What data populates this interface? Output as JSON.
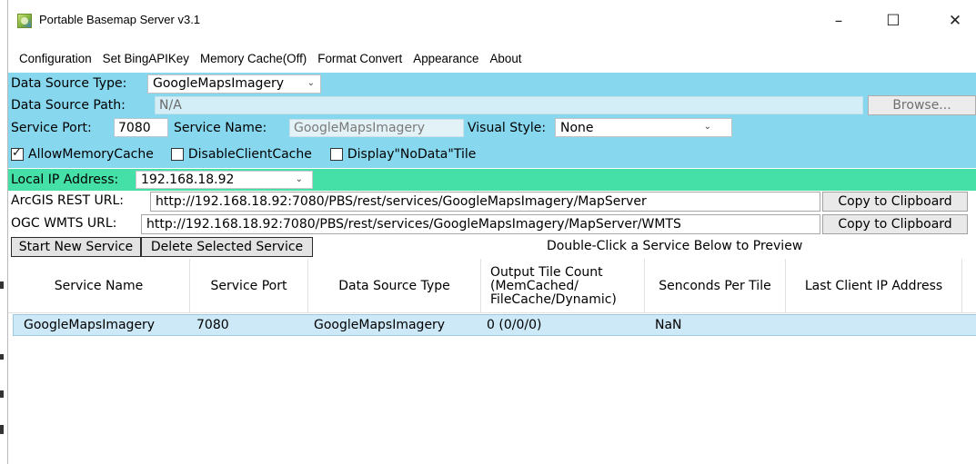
{
  "window": {
    "title": "Portable Basemap Server v3.1",
    "controls": {
      "minimize": "–",
      "maximize": "☐",
      "close": "✕"
    }
  },
  "menu": {
    "items": [
      "Configuration",
      "Set BingAPIKey",
      "Memory Cache(Off)",
      "Format Convert",
      "Appearance",
      "About"
    ]
  },
  "config": {
    "data_source_type_label": "Data Source Type:",
    "data_source_type_value": "GoogleMapsImagery",
    "data_source_path_label": "Data Source Path:",
    "data_source_path_value": "N/A",
    "browse_label": "Browse...",
    "service_port_label": "Service Port:",
    "service_port_value": "7080",
    "service_name_label": "Service Name:",
    "service_name_value": "GoogleMapsImagery",
    "visual_style_label": "Visual Style:",
    "visual_style_value": "None",
    "checkboxes": [
      {
        "label": "AllowMemoryCache",
        "checked": true
      },
      {
        "label": "DisableClientCache",
        "checked": false
      },
      {
        "label": "Display\"NoData\"Tile",
        "checked": false
      }
    ]
  },
  "network": {
    "local_ip_label": "Local IP Address:",
    "local_ip_value": "192.168.18.92",
    "arcgis_label": "ArcGIS REST URL:",
    "arcgis_url": "http://192.168.18.92:7080/PBS/rest/services/GoogleMapsImagery/MapServer",
    "wmts_label": "OGC WMTS URL:",
    "wmts_url": "http://192.168.18.92:7080/PBS/rest/services/GoogleMapsImagery/MapServer/WMTS",
    "copy_label": "Copy to Clipboard"
  },
  "actions": {
    "start_label": "Start New Service",
    "delete_label": "Delete Selected Service",
    "hint": "Double-Click a Service Below to Preview"
  },
  "grid": {
    "columns": [
      "Service Name",
      "Service Port",
      "Data Source Type",
      "Output Tile Count\n(MemCached/\nFileCache/Dynamic)",
      "Senconds Per Tile",
      "Last Client IP Address"
    ],
    "rows": [
      [
        "GoogleMapsImagery",
        "7080",
        "GoogleMapsImagery",
        "0 (0/0/0)",
        "NaN",
        ""
      ]
    ]
  },
  "colors": {
    "config_bg": "#87d7ef",
    "ip_bar_bg": "#44e0a7",
    "selected_row_bg": "#cde8f7"
  }
}
